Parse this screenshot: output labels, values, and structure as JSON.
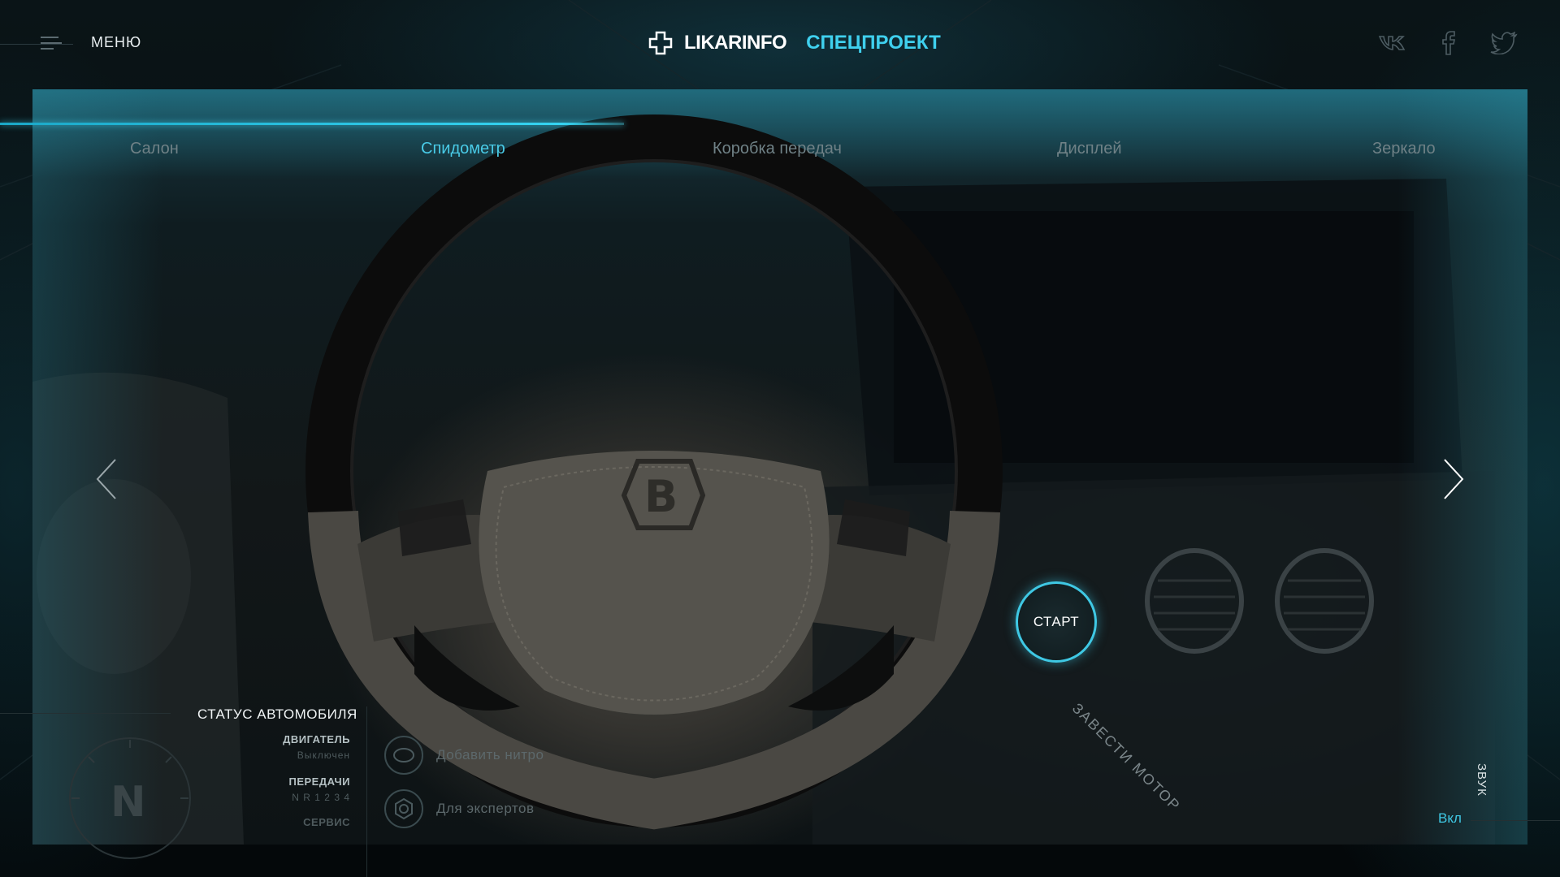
{
  "header": {
    "menu_label": "МЕНЮ",
    "brand_name": "LIKARINFO",
    "brand_project": "СПЕЦПРОЕКТ",
    "social": [
      "vk-icon",
      "facebook-icon",
      "twitter-icon"
    ]
  },
  "progress": {
    "fraction": 0.4
  },
  "tabs": [
    {
      "label": "Салон",
      "active": false
    },
    {
      "label": "Спидометр",
      "active": true
    },
    {
      "label": "Коробка передач",
      "active": false
    },
    {
      "label": "Дисплей",
      "active": false
    },
    {
      "label": "Зеркало",
      "active": false
    }
  ],
  "start": {
    "label": "СТАРТ",
    "hint": "ЗАВЕСТИ МОТОР"
  },
  "status": {
    "title": "СТАТУС АВТОМОБИЛЯ",
    "engine_label": "ДВИГАТЕЛЬ",
    "engine_value": "Выключен",
    "gears_label": "ПЕРЕДАЧИ",
    "gears_value": "N R 1 2 3 4",
    "service_label": "СЕРВИС",
    "gear_indicator": "N"
  },
  "options": [
    {
      "label": "Добавить нитро",
      "icon": "nitro-icon"
    },
    {
      "label": "Для экспертов",
      "icon": "expert-icon"
    }
  ],
  "sound": {
    "label": "ЗВУК",
    "value": "Вкл"
  },
  "colors": {
    "accent": "#3fc8e4",
    "background": "#05090c"
  }
}
